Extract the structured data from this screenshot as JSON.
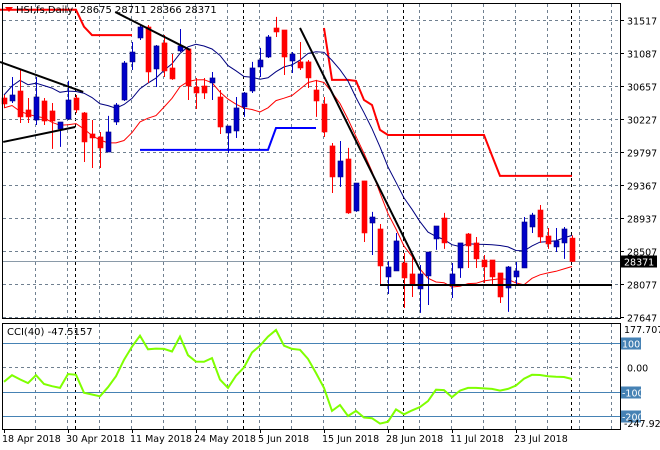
{
  "header": {
    "symbol_label": "HSI,fs,Daily",
    "ohlc_label": "28675 28711 28366 28371",
    "menu_icon": "triangle-down-icon"
  },
  "colors": {
    "bull": "#0000c8",
    "bear": "#ff0000",
    "ma_high": "#000080",
    "ma_low": "#ff0000",
    "step_red": "#ff0000",
    "step_blue": "#0000ff",
    "cci": "#7fff00",
    "level": "#4682b4",
    "grid": "#708090"
  },
  "chart_data": [
    {
      "type": "candlestick",
      "title": "HSI,fs,Daily",
      "current_price_label": "28371",
      "ylim": [
        27647,
        31517
      ],
      "y_ticks": [
        "31517",
        "31087",
        "30657",
        "30227",
        "29797",
        "29367",
        "28937",
        "28507",
        "28077",
        "27647"
      ],
      "x_tick_labels": [
        {
          "index": 0,
          "label": "18 Apr 2018"
        },
        {
          "index": 8,
          "label": "30 Apr 2018"
        },
        {
          "index": 16,
          "label": "11 May 2018"
        },
        {
          "index": 24,
          "label": "24 May 2018"
        },
        {
          "index": 32,
          "label": "5 Jun 2018"
        },
        {
          "index": 40,
          "label": "15 Jun 2018"
        },
        {
          "index": 48,
          "label": "28 Jun 2018"
        },
        {
          "index": 56,
          "label": "11 Jul 2018"
        },
        {
          "index": 64,
          "label": "23 Jul 2018"
        }
      ],
      "period_separators": [
        8.9,
        29.9,
        49.9,
        70.9
      ],
      "ohlc": [
        [
          30501,
          30540,
          30371,
          30423
        ],
        [
          30462,
          30775,
          30436,
          30540
        ],
        [
          30592,
          30879,
          30175,
          30254
        ],
        [
          30345,
          30501,
          30175,
          30254
        ],
        [
          30214,
          30775,
          30149,
          30514
        ],
        [
          30462,
          30501,
          30149,
          30201
        ],
        [
          30332,
          30436,
          29837,
          30201
        ],
        [
          30097,
          30188,
          29863,
          30188
        ],
        [
          30227,
          30723,
          30214,
          30475
        ],
        [
          30501,
          30540,
          30306,
          30345
        ],
        [
          30306,
          30319,
          29667,
          29928
        ],
        [
          30032,
          30214,
          29589,
          29980
        ],
        [
          29993,
          30058,
          29589,
          29850
        ],
        [
          29797,
          30267,
          29797,
          30058
        ],
        [
          30188,
          30436,
          30149,
          30410
        ],
        [
          30475,
          30983,
          30462,
          30957
        ],
        [
          30971,
          31231,
          30866,
          31100
        ],
        [
          31283,
          31452,
          31257,
          31426
        ],
        [
          31426,
          31452,
          30697,
          30840
        ],
        [
          30879,
          31192,
          30644,
          31179
        ],
        [
          31218,
          31322,
          30775,
          30853
        ],
        [
          30892,
          31074,
          30736,
          30749
        ],
        [
          31114,
          31400,
          31100,
          31179
        ],
        [
          31140,
          31140,
          30475,
          30657
        ],
        [
          30644,
          30762,
          30358,
          30566
        ],
        [
          30657,
          30762,
          30488,
          30566
        ],
        [
          30697,
          30840,
          30475,
          30762
        ],
        [
          30514,
          30605,
          30032,
          30123
        ],
        [
          30045,
          30136,
          29784,
          30136
        ],
        [
          30071,
          30514,
          29980,
          30371
        ],
        [
          30384,
          30579,
          30254,
          30566
        ],
        [
          30592,
          30971,
          30566,
          30892
        ],
        [
          30905,
          31153,
          30775,
          30996
        ],
        [
          31035,
          31322,
          31022,
          31296
        ],
        [
          31413,
          31557,
          31296,
          31361
        ],
        [
          31387,
          31387,
          30801,
          31035
        ],
        [
          30983,
          31100,
          30827,
          31074
        ],
        [
          30971,
          31231,
          30866,
          30892
        ],
        [
          30971,
          30996,
          30631,
          30762
        ],
        [
          30605,
          30736,
          30254,
          30462
        ],
        [
          30423,
          30514,
          29993,
          30058
        ],
        [
          29876,
          29915,
          29263,
          29472
        ],
        [
          29472,
          29941,
          29342,
          29680
        ],
        [
          29706,
          29850,
          28990,
          29003
        ],
        [
          29029,
          29393,
          29016,
          29393
        ],
        [
          29420,
          29420,
          28625,
          28742
        ],
        [
          28872,
          29016,
          28455,
          28950
        ],
        [
          28794,
          28859,
          28064,
          28312
        ],
        [
          28169,
          28377,
          27947,
          28299
        ],
        [
          28247,
          28742,
          28247,
          28638
        ],
        [
          28351,
          28481,
          27765,
          28156
        ],
        [
          28208,
          28429,
          27908,
          28064
        ],
        [
          28013,
          28325,
          27700,
          28208
        ],
        [
          28182,
          28494,
          27804,
          28494
        ],
        [
          28664,
          28833,
          28521,
          28833
        ],
        [
          28937,
          29003,
          28534,
          28612
        ],
        [
          28064,
          28351,
          27895,
          28208
        ],
        [
          28286,
          28612,
          28156,
          28612
        ],
        [
          28729,
          28742,
          28286,
          28573
        ],
        [
          28612,
          28690,
          28286,
          28404
        ],
        [
          28390,
          28455,
          28090,
          28299
        ],
        [
          28390,
          28390,
          28064,
          28169
        ],
        [
          28221,
          28221,
          27830,
          27908
        ],
        [
          28025,
          28312,
          27713,
          28299
        ],
        [
          28169,
          28364,
          28064,
          28247
        ],
        [
          28286,
          28950,
          28286,
          28885
        ],
        [
          28820,
          29003,
          28742,
          28976
        ],
        [
          29041,
          29107,
          28612,
          28690
        ],
        [
          28703,
          28807,
          28534,
          28599
        ],
        [
          28560,
          28807,
          28494,
          28638
        ],
        [
          28612,
          28820,
          28404,
          28794
        ],
        [
          28675,
          28711,
          28366,
          28371
        ]
      ],
      "ma_period": 10,
      "step_red": [
        [
          [
            -1,
            31650
          ],
          [
            9,
            31650
          ],
          [
            10,
            31430
          ],
          [
            11,
            31320
          ],
          [
            16,
            31320
          ]
        ],
        [
          [
            40,
            31413
          ],
          [
            41,
            30736
          ],
          [
            43,
            30736
          ],
          [
            44,
            30723
          ],
          [
            45,
            30475
          ],
          [
            46,
            30410
          ],
          [
            47,
            30085
          ],
          [
            48,
            30019
          ],
          [
            60,
            30019
          ],
          [
            61,
            29750
          ],
          [
            62,
            29485
          ],
          [
            71,
            29485
          ]
        ]
      ],
      "step_blue": [
        [
          17,
          29824
        ],
        [
          33,
          29824
        ],
        [
          34,
          30110
        ],
        [
          39,
          30110
        ]
      ],
      "trendlines": [
        [
          [
            -0.5,
            30971
          ],
          [
            9.9,
            30579
          ]
        ],
        [
          [
            -0.1,
            29928
          ],
          [
            8.9,
            30123
          ]
        ],
        [
          [
            13.9,
            31622
          ],
          [
            23.25,
            31127
          ]
        ],
        [
          [
            37,
            31413
          ],
          [
            52,
            28260
          ]
        ],
        [
          [
            47,
            28064
          ],
          [
            76,
            28064
          ]
        ]
      ]
    },
    {
      "type": "line",
      "title": "CCI(40) -47.5157",
      "ylim": [
        -247.929,
        177.7073
      ],
      "y_labels": {
        "top": "177.7073",
        "bottom": "-247.929",
        "zero": "0.00"
      },
      "levels": [
        {
          "value": 100,
          "label": "100"
        },
        {
          "value": -100,
          "label": "-100"
        },
        {
          "value": -200,
          "label": "-200"
        }
      ],
      "values": [
        -59,
        -32,
        -49,
        -64,
        -32,
        -68,
        -77,
        -84,
        -27,
        -30,
        -104,
        -111,
        -118,
        -81,
        -36,
        31,
        85,
        130,
        74,
        77,
        76,
        65,
        126,
        50,
        24,
        23,
        38,
        -50,
        -84,
        -34,
        0,
        61,
        89,
        126,
        153,
        89,
        76,
        72,
        35,
        -23,
        -84,
        -178,
        -154,
        -199,
        -178,
        -205,
        -208,
        -230,
        -222,
        -172,
        -192,
        -176,
        -162,
        -138,
        -91,
        -93,
        -122,
        -95,
        -84,
        -84,
        -86,
        -88,
        -95,
        -88,
        -74,
        -46,
        -30,
        -31,
        -36,
        -38,
        -39,
        -47.5157
      ]
    }
  ]
}
